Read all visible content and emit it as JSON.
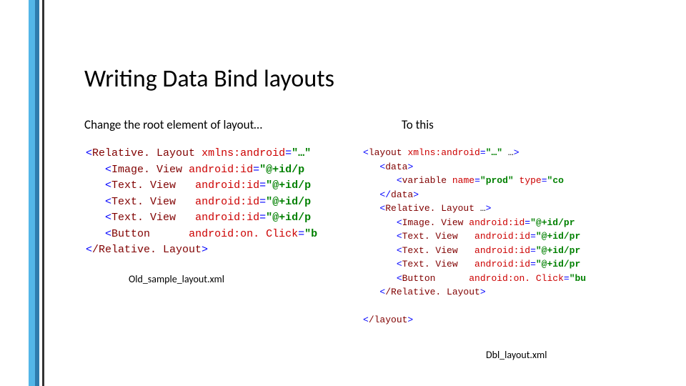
{
  "title": "Writing Data Bind layouts",
  "subhead_left": "Change the root element of layout…",
  "subhead_right": "To this",
  "caption_left": "Old_sample_layout.xml",
  "caption_right": "Dbl_layout.xml",
  "code_left": {
    "line1_tag": "Relative. Layout",
    "line1_attr": "xmlns:android",
    "line1_val": "\"…\"",
    "img_tag": "Image. View",
    "txt_tag": "Text. View",
    "btn_tag": "Button",
    "attr_id": "android:id",
    "attr_click": "android:on. Click",
    "val_idp": "\"@+id/p",
    "val_click": "\"b",
    "close_tag": "/Relative. Layout"
  },
  "code_right": {
    "layout_tag": "layout",
    "xmlns_attr": "xmlns:android",
    "xmlns_val": "\"…\"",
    "ellipsis": " …",
    "data_tag": "data",
    "variable_tag": "variable",
    "name_attr": "name",
    "name_val": "\"prod\"",
    "type_attr": "type",
    "type_val": "\"co",
    "rel_tag": "Relative. Layout",
    "img_tag": "Image. View",
    "txt_tag": "Text. View",
    "btn_tag": "Button",
    "attr_id": "android:id",
    "attr_click": "android:on. Click",
    "val_pr": "\"@+id/pr",
    "val_buy": "\"bu",
    "close_rel": "/Relative. Layout",
    "close_layout": "/layout"
  }
}
